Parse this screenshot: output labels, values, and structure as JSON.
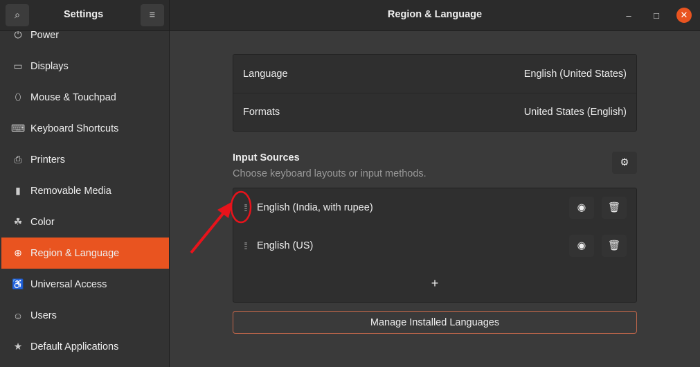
{
  "sidebar": {
    "title": "Settings",
    "items": [
      {
        "label": "Power",
        "icon": "power-icon",
        "g": "⏻"
      },
      {
        "label": "Displays",
        "icon": "display-icon",
        "g": "▭"
      },
      {
        "label": "Mouse & Touchpad",
        "icon": "mouse-icon",
        "g": "⬯"
      },
      {
        "label": "Keyboard Shortcuts",
        "icon": "keyboard-icon",
        "g": "⌨"
      },
      {
        "label": "Printers",
        "icon": "printer-icon",
        "g": "⎙"
      },
      {
        "label": "Removable Media",
        "icon": "media-icon",
        "g": "▮"
      },
      {
        "label": "Color",
        "icon": "color-icon",
        "g": "☘"
      },
      {
        "label": "Region & Language",
        "icon": "globe-icon",
        "g": "⊕"
      },
      {
        "label": "Universal Access",
        "icon": "accessibility-icon",
        "g": "♿"
      },
      {
        "label": "Users",
        "icon": "users-icon",
        "g": "☺"
      },
      {
        "label": "Default Applications",
        "icon": "star-icon",
        "g": "★"
      }
    ]
  },
  "window": {
    "title": "Region & Language"
  },
  "region": {
    "language_label": "Language",
    "language_value": "English (United States)",
    "formats_label": "Formats",
    "formats_value": "United States (English)"
  },
  "input_sources": {
    "title": "Input Sources",
    "subtitle": "Choose keyboard layouts or input methods.",
    "items": [
      "English (India, with rupee)",
      "English (US)"
    ],
    "add": "+"
  },
  "manage_label": "Manage Installed Languages",
  "colors": {
    "accent": "#e95420",
    "annotation": "#e8131b"
  }
}
